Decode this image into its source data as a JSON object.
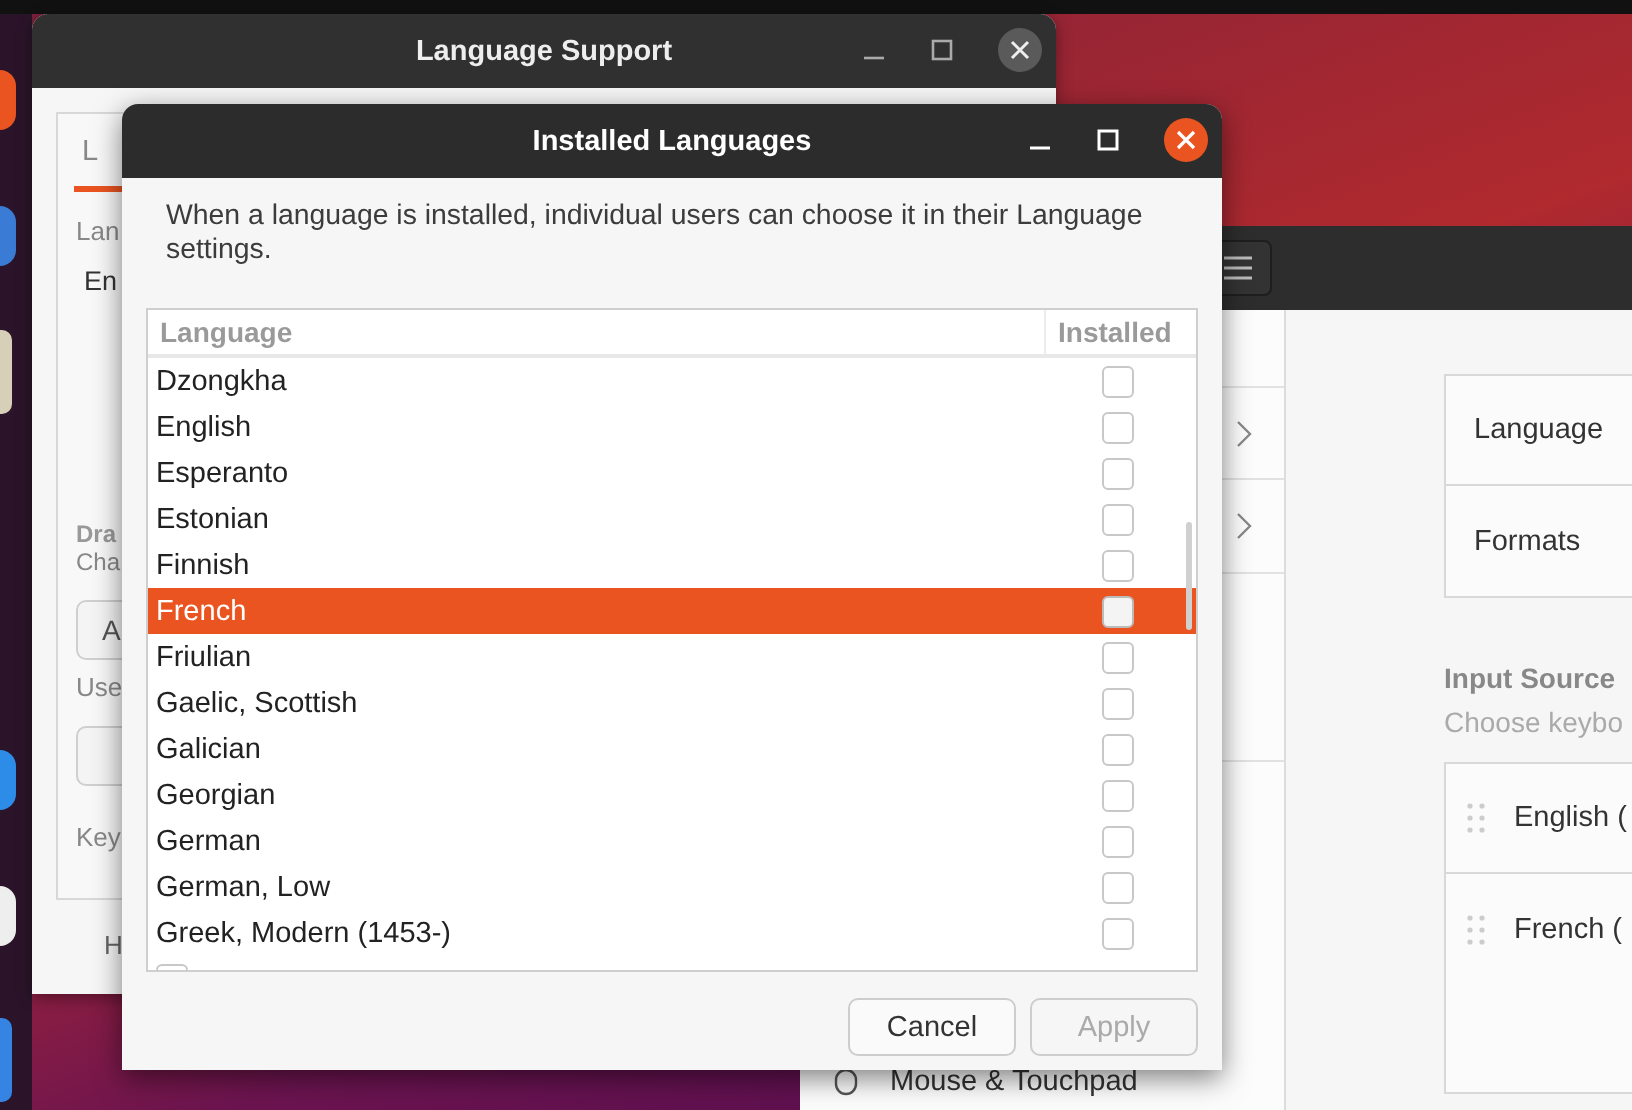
{
  "language_support_window": {
    "title": "Language Support",
    "tab": "L",
    "language_label": "Lan",
    "language_value": "En",
    "section_heading": "Dra",
    "section_caption": "Cha",
    "first_button": "A",
    "use_caption": "Use",
    "keyboard_label": "Key",
    "help_button": "H"
  },
  "settings_window": {
    "sidebar_items": [
      {
        "label": "Mouse & Touchpad"
      }
    ],
    "region_rows": [
      {
        "label": "Language"
      },
      {
        "label": "Formats"
      }
    ],
    "input_sources_heading": "Input Source",
    "input_sources_caption": "Choose keybo",
    "input_sources": [
      {
        "label": "English ("
      },
      {
        "label": "French ("
      }
    ]
  },
  "installed_languages_dialog": {
    "title": "Installed Languages",
    "description": "When a language is installed, individual users can choose it in their Language settings.",
    "columns": [
      "Language",
      "Installed"
    ],
    "rows": [
      {
        "name": "Dzongkha",
        "installed": false,
        "selected": false
      },
      {
        "name": "English",
        "installed": false,
        "selected": false
      },
      {
        "name": "Esperanto",
        "installed": false,
        "selected": false
      },
      {
        "name": "Estonian",
        "installed": false,
        "selected": false
      },
      {
        "name": "Finnish",
        "installed": false,
        "selected": false
      },
      {
        "name": "French",
        "installed": false,
        "selected": true
      },
      {
        "name": "Friulian",
        "installed": false,
        "selected": false
      },
      {
        "name": "Gaelic, Scottish",
        "installed": false,
        "selected": false
      },
      {
        "name": "Galician",
        "installed": false,
        "selected": false
      },
      {
        "name": "Georgian",
        "installed": false,
        "selected": false
      },
      {
        "name": "German",
        "installed": false,
        "selected": false
      },
      {
        "name": "German, Low",
        "installed": false,
        "selected": false
      },
      {
        "name": "Greek, Modern (1453-)",
        "installed": false,
        "selected": false
      }
    ],
    "buttons": [
      {
        "label": "Cancel",
        "disabled": false
      },
      {
        "label": "Apply",
        "disabled": true
      }
    ]
  }
}
